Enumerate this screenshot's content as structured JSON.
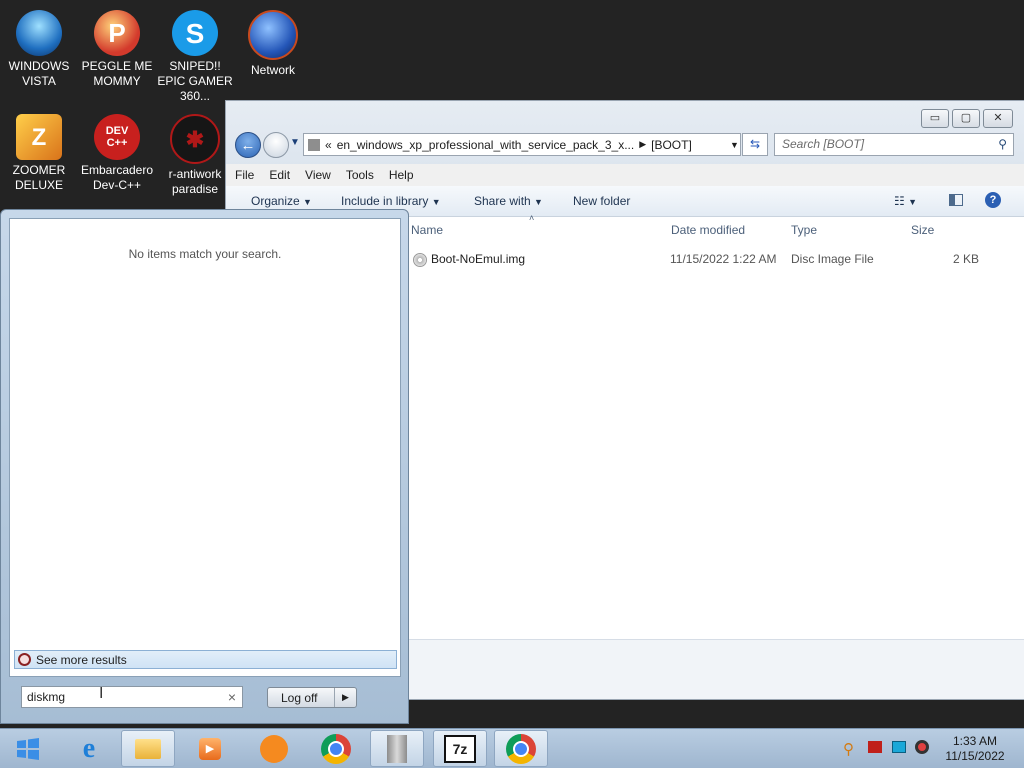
{
  "desktop": {
    "icons": [
      {
        "label": "WINDOWS VISTA",
        "icon": "vista-bowl-icon",
        "color": "#2f8fd8"
      },
      {
        "label": "PEGGLE ME MOMMY",
        "icon": "peggle-icon",
        "color": "#d33a2c"
      },
      {
        "label": "SNIPED!! EPIC GAMER 360...",
        "icon": "skype-icon",
        "color": "#1a9be8"
      },
      {
        "label": "Network",
        "icon": "network-globe-icon",
        "color": "#2456b8"
      },
      {
        "label": "ZOOMER DELUXE",
        "icon": "zoomer-icon",
        "color": "#e08a1a"
      },
      {
        "label": "Embarcadero Dev-C++",
        "icon": "devcpp-icon",
        "color": "#c8201e",
        "badge": "DEV C++"
      },
      {
        "label": "r-antiwork paradise",
        "icon": "antiwork-icon",
        "color": "#161616"
      }
    ]
  },
  "explorer": {
    "address_prefix": "«",
    "address_folder": "en_windows_xp_professional_with_service_pack_3_x...",
    "address_current": "[BOOT]",
    "search_placeholder": "Search [BOOT]",
    "menu": [
      "File",
      "Edit",
      "View",
      "Tools",
      "Help"
    ],
    "toolbar": {
      "organize": "Organize",
      "include": "Include in library",
      "share": "Share with",
      "new_folder": "New folder"
    },
    "columns": {
      "name": "Name",
      "date": "Date modified",
      "type": "Type",
      "size": "Size"
    },
    "files": [
      {
        "name": "Boot-NoEmul.img",
        "date": "11/15/2022 1:22 AM",
        "type": "Disc Image File",
        "size": "2 KB"
      }
    ]
  },
  "startmenu": {
    "no_items": "No items match your search.",
    "see_more": "See more results",
    "search_value": "diskmg",
    "logoff": "Log off",
    "clear": "×"
  },
  "taskbar": {
    "time": "1:33 AM",
    "date": "11/15/2022"
  }
}
